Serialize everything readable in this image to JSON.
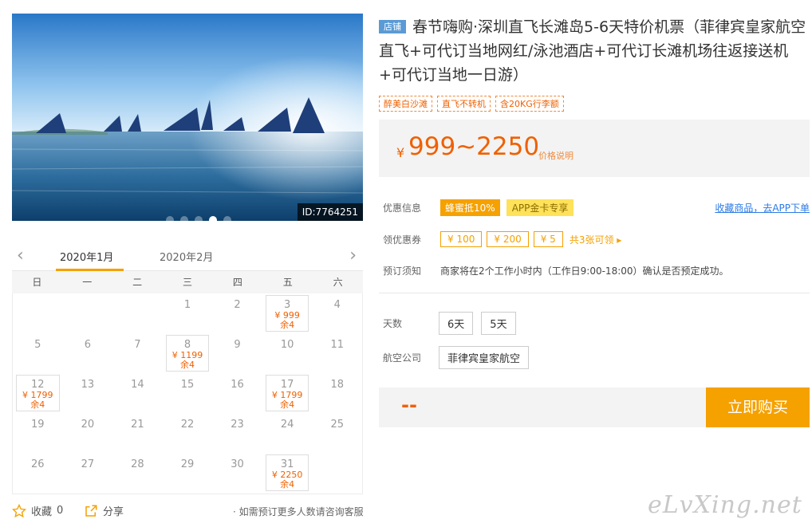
{
  "gallery": {
    "id_label": "ID:7764251",
    "dots": 5,
    "active_dot": 3
  },
  "calendar": {
    "prev_icon": "chevron-left-icon",
    "next_icon": "chevron-right-icon",
    "tabs": [
      "2020年1月",
      "2020年2月"
    ],
    "active_tab": 0,
    "weekdays": [
      "日",
      "一",
      "二",
      "三",
      "四",
      "五",
      "六"
    ],
    "rows": [
      [
        {
          "d": ""
        },
        {
          "d": ""
        },
        {
          "d": ""
        },
        {
          "d": "1"
        },
        {
          "d": "2"
        },
        {
          "d": "3",
          "p": "¥ 999",
          "r": "余4"
        },
        {
          "d": "4"
        }
      ],
      [
        {
          "d": "5"
        },
        {
          "d": "6"
        },
        {
          "d": "7"
        },
        {
          "d": "8",
          "p": "¥ 1199",
          "r": "余4"
        },
        {
          "d": "9"
        },
        {
          "d": "10"
        },
        {
          "d": "11"
        }
      ],
      [
        {
          "d": "12",
          "p": "¥ 1799",
          "r": "余4"
        },
        {
          "d": "13"
        },
        {
          "d": "14"
        },
        {
          "d": "15"
        },
        {
          "d": "16"
        },
        {
          "d": "17",
          "p": "¥ 1799",
          "r": "余4"
        },
        {
          "d": "18"
        }
      ],
      [
        {
          "d": "19"
        },
        {
          "d": "20"
        },
        {
          "d": "21"
        },
        {
          "d": "22"
        },
        {
          "d": "23"
        },
        {
          "d": "24"
        },
        {
          "d": "25"
        }
      ],
      [
        {
          "d": "26"
        },
        {
          "d": "27"
        },
        {
          "d": "28"
        },
        {
          "d": "29"
        },
        {
          "d": "30"
        },
        {
          "d": "31",
          "p": "¥ 2250",
          "r": "余4"
        },
        {
          "d": ""
        }
      ]
    ]
  },
  "footer": {
    "fav_label": "收藏",
    "fav_count": "0",
    "share_label": "分享",
    "note": "· 如需预订更多人数请咨询客服"
  },
  "product": {
    "badge": "店铺",
    "title": "春节嗨购·深圳直飞长滩岛5-6天特价机票（菲律宾皇家航空直飞+可代订当地网红/泳池酒店+可代订长滩机场往返接送机+可代订当地一日游）",
    "tags": [
      "醉美白沙滩",
      "直飞不转机",
      "含20KG行李额"
    ],
    "price_symbol": "¥",
    "price": "999~2250",
    "price_note": "价格说明",
    "promo_label": "优惠信息",
    "promo_chips": [
      "蜂蜜抵10%",
      "APP金卡专享"
    ],
    "app_link": "收藏商品，去APP下单",
    "coupon_label": "领优惠券",
    "coupons": [
      "¥ 100",
      "¥ 200",
      "¥ 5"
    ],
    "coupon_more": "共3张可领 ▸",
    "notice_label": "预订须知",
    "notice": "商家将在2个工作小时内（工作日9:00-18:00）确认是否预定成功。",
    "days_label": "天数",
    "days_options": [
      "6天",
      "5天"
    ],
    "airline_label": "航空公司",
    "airline_options": [
      "菲律宾皇家航空"
    ],
    "buy_price": "--",
    "buy_button": "立即购买"
  },
  "watermark": "eLvXing.net",
  "colors": {
    "accent": "#f5a100",
    "price": "#f06000",
    "link": "#2c7be5"
  }
}
